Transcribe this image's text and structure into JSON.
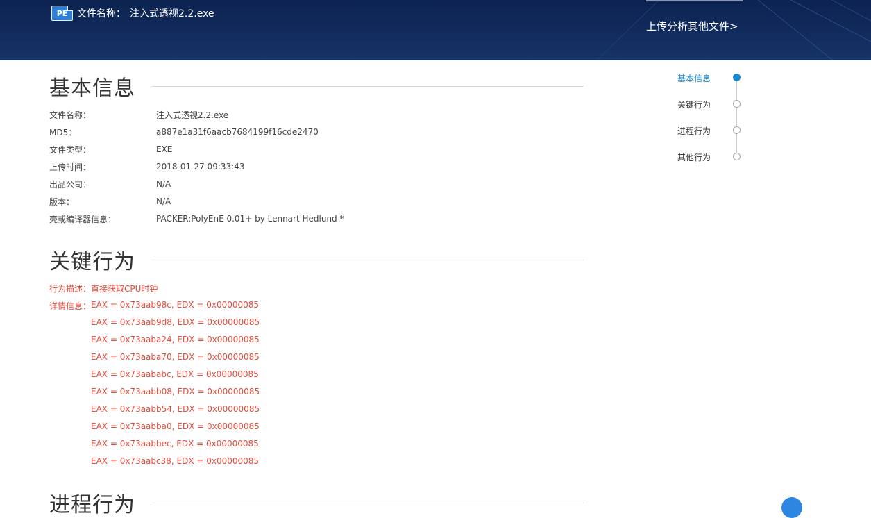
{
  "header": {
    "file_label": "文件名称：",
    "file_name": "注入式透视2.2.exe",
    "pe_icon_text": "PE",
    "upload_link": "上传分析其他文件>"
  },
  "basic": {
    "title": "基本信息",
    "rows": [
      {
        "key": "文件名称：",
        "value": "注入式透视2.2.exe"
      },
      {
        "key": "MD5：",
        "value": "a887e1a31f6aacb7684199f16cde2470"
      },
      {
        "key": "文件类型：",
        "value": "EXE"
      },
      {
        "key": "上传时间：",
        "value": "2018-01-27 09:33:43"
      },
      {
        "key": "出品公司：",
        "value": "N/A"
      },
      {
        "key": "版本：",
        "value": "N/A"
      },
      {
        "key": "壳或编译器信息：",
        "value": "PACKER:PolyEnE 0.01+ by Lennart Hedlund *"
      }
    ]
  },
  "key_behavior": {
    "title": "关键行为",
    "desc_label": "行为描述：",
    "desc_value": "直接获取CPU时钟",
    "detail_label": "详情信息：",
    "details": [
      "EAX = 0x73aab98c, EDX = 0x00000085",
      "EAX = 0x73aab9d8, EDX = 0x00000085",
      "EAX = 0x73aaba24, EDX = 0x00000085",
      "EAX = 0x73aaba70, EDX = 0x00000085",
      "EAX = 0x73aababc, EDX = 0x00000085",
      "EAX = 0x73aabb08, EDX = 0x00000085",
      "EAX = 0x73aabb54, EDX = 0x00000085",
      "EAX = 0x73aabba0, EDX = 0x00000085",
      "EAX = 0x73aabbec, EDX = 0x00000085",
      "EAX = 0x73aabc38, EDX = 0x00000085"
    ],
    "color": "#e34c3c"
  },
  "process": {
    "title": "进程行为"
  },
  "nav": {
    "items": [
      {
        "label": "基本信息",
        "active": true
      },
      {
        "label": "关键行为",
        "active": false
      },
      {
        "label": "进程行为",
        "active": false
      },
      {
        "label": "其他行为",
        "active": false
      }
    ],
    "accent": "#1a8ad4"
  }
}
